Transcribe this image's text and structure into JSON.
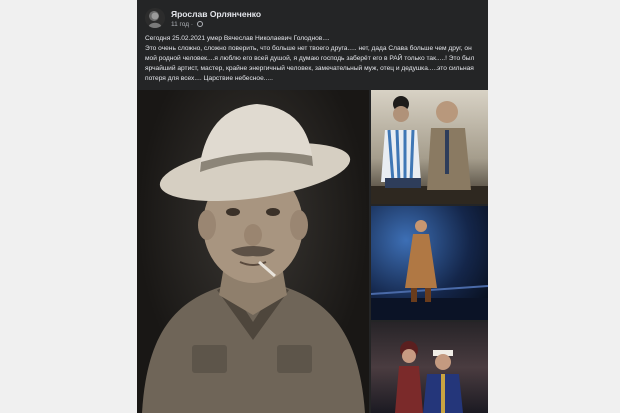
{
  "post": {
    "author": "Ярослав Орлянченко",
    "time": "11 год",
    "separator": "·",
    "text_lines": [
      "Сегодня 25.02.2021 умер Вячеслав Николаевич Голоднов....",
      "Это очень сложно, сложно поверить, что больше нет твоего друга..... нет, дада Слава больше чем друг, он мой родной человек....я люблю его всей душой, я думаю господь заберёт его в РАЙ только так.....! Это был ярчайший артист, мастер, крайне энергичный человек, замечательный муж, отец и дедушка.....это сильная потеря для всех.... Царствие небесное....."
    ]
  },
  "icons": {
    "audience": "globe-icon"
  },
  "colors": {
    "card_bg": "#242526",
    "page_bg": "#f0f0f0",
    "text": "#e4e6eb",
    "secondary_text": "#b0b3b8"
  }
}
